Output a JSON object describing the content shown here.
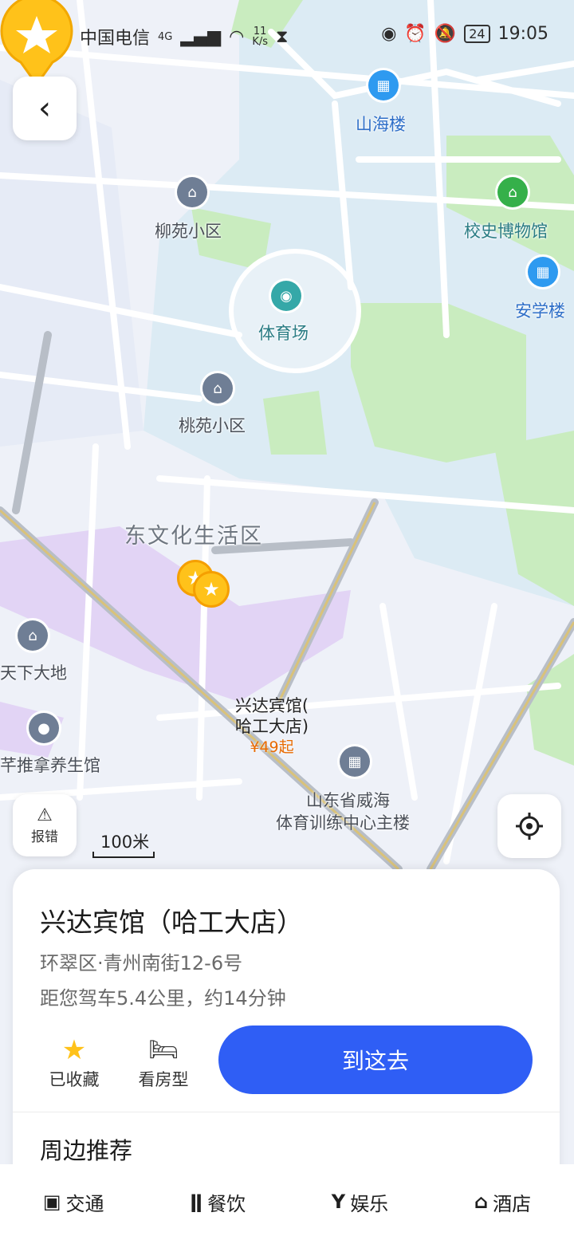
{
  "status_bar": {
    "carrier": "中国电信",
    "network": "4G",
    "net_speed_value": "11",
    "net_speed_unit": "K/s",
    "battery": "24",
    "time": "19:05"
  },
  "map": {
    "labels": {
      "shanhai": "山海楼",
      "liuyuan": "柳苑小区",
      "museum": "校史博物馆",
      "anxue": "安学楼",
      "stadium": "体育场",
      "taoyuan": "桃苑小区",
      "district": "东文化生活区",
      "tianxia": "天下大地",
      "massage": "芊推拿养生馆",
      "training_line1": "山东省威海",
      "training_line2": "体育训练中心主楼"
    },
    "pin": {
      "name_line1": "兴达宾馆(",
      "name_line2": "哈工大店)",
      "price": "¥49起"
    },
    "scale": "100米",
    "report_label": "报错"
  },
  "card": {
    "title": "兴达宾馆（哈工大店）",
    "address": "环翠区·青州南街12-6号",
    "distance": "距您驾车5.4公里，约14分钟",
    "favorite_label": "已收藏",
    "room_label": "看房型",
    "go_label": "到这去",
    "nearby_title": "周边推荐"
  },
  "tabs": [
    {
      "label": "交通",
      "icon": "bus-icon"
    },
    {
      "label": "餐饮",
      "icon": "fork-knife-icon"
    },
    {
      "label": "娱乐",
      "icon": "cocktail-icon"
    },
    {
      "label": "酒店",
      "icon": "hotel-icon"
    }
  ],
  "colors": {
    "accent": "#2f5ef5",
    "pin": "#ffc21a",
    "price": "#e86a00",
    "park": "#c9ecbf",
    "campus": "#dcebf4",
    "purple_area": "#e2d4f5"
  }
}
